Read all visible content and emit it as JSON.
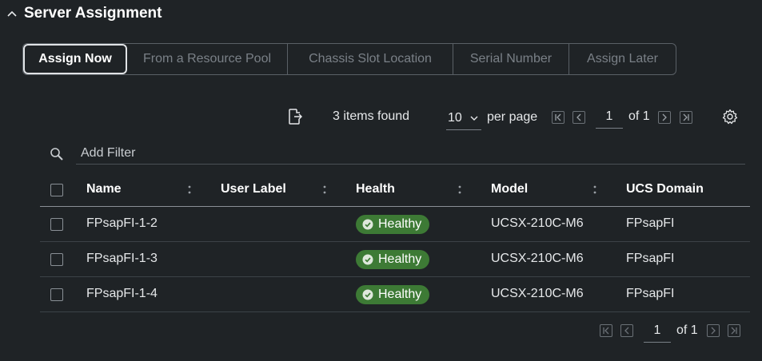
{
  "section": {
    "title": "Server Assignment"
  },
  "tabs": [
    {
      "label": "Assign Now",
      "active": true
    },
    {
      "label": "From a Resource Pool",
      "active": false
    },
    {
      "label": "Chassis Slot Location",
      "active": false
    },
    {
      "label": "Serial Number",
      "active": false
    },
    {
      "label": "Assign Later",
      "active": false
    }
  ],
  "toolbar": {
    "items_found": "3 items found",
    "per_page_value": "10",
    "per_page_label": "per page",
    "page_value": "1",
    "of_label": "of 1"
  },
  "filter": {
    "placeholder": "Add Filter"
  },
  "columns": [
    "Name",
    "User Label",
    "Health",
    "Model",
    "UCS Domain"
  ],
  "rows": [
    {
      "name": "FPsapFI-1-2",
      "user_label": "",
      "health": "Healthy",
      "model": "UCSX-210C-M6",
      "domain": "FPsapFI"
    },
    {
      "name": "FPsapFI-1-3",
      "user_label": "",
      "health": "Healthy",
      "model": "UCSX-210C-M6",
      "domain": "FPsapFI"
    },
    {
      "name": "FPsapFI-1-4",
      "user_label": "",
      "health": "Healthy",
      "model": "UCSX-210C-M6",
      "domain": "FPsapFI"
    }
  ],
  "bottom_pager": {
    "page_value": "1",
    "of_label": "of 1"
  },
  "colors": {
    "background": "#1f2326",
    "healthy": "#3d7a35",
    "border": "#5a6066"
  },
  "icons": [
    "chevron-up-icon",
    "export-icon",
    "chevron-down-icon",
    "first-page-icon",
    "prev-page-icon",
    "next-page-icon",
    "last-page-icon",
    "gear-icon",
    "search-icon",
    "sort-icon",
    "check-circle-icon"
  ]
}
